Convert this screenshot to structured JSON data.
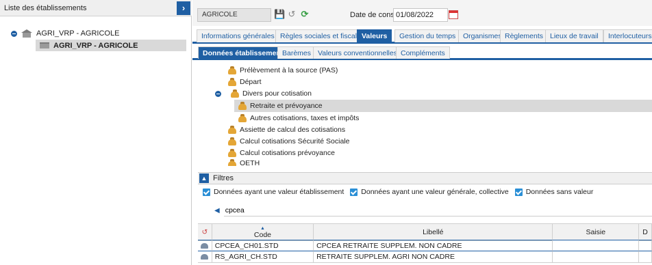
{
  "left_panel": {
    "title": "Liste des établissements",
    "collapse_glyph": "›",
    "tree": {
      "root_label": "AGRI_VRP - AGRICOLE",
      "child_label": "AGRI_VRP - AGRICOLE"
    }
  },
  "toolbar": {
    "establishment_value": "AGRICOLE",
    "save_icon": "save-icon",
    "undo_icon": "undo-icon",
    "refresh_icon": "refresh-icon",
    "consult_label": "Date de consultation",
    "consult_date": "01/08/2022",
    "calendar_icon": "calendar-icon"
  },
  "main_tabs": [
    "Informations générales",
    "Règles sociales et fiscales",
    "Valeurs",
    "Gestion du temps",
    "Organismes",
    "Règlements",
    "Lieux de travail",
    "Interlocuteurs"
  ],
  "main_tab_active": "Valeurs",
  "sub_tabs": [
    "Données établissement",
    "Barèmes",
    "Valeurs conventionnelles",
    "Compléments"
  ],
  "sub_tab_active": "Données établissement",
  "items": [
    "Prélèvement à la source (PAS)",
    "Départ",
    "Divers pour cotisation",
    "Retraite et prévoyance",
    "Autres cotisations, taxes et impôts",
    "Assiette de calcul des cotisations",
    "Calcul cotisations Sécurité Sociale",
    "Calcul cotisations prévoyance",
    "OETH"
  ],
  "selected_item": "Retraite et prévoyance",
  "filters": {
    "title": "Filtres",
    "options": [
      "Données ayant une valeur établissement",
      "Données ayant une valeur générale, collective",
      "Données sans valeur"
    ],
    "all_checked": true,
    "search_value": "cpcea"
  },
  "table": {
    "headers": [
      "Code",
      "Libellé",
      "Saisie",
      "D"
    ],
    "rows": [
      {
        "code": "CPCEA_CH01.STD",
        "libelle": "CPCEA  RETRAITE SUPPLEM. NON CADRE",
        "saisie": ""
      },
      {
        "code": "RS_AGRI_CH.STD",
        "libelle": "RETRAITE SUPPLEM. AGRI NON CADRE",
        "saisie": ""
      }
    ]
  },
  "colors": {
    "accent": "#1f5fa3",
    "selection": "#d9d9d9",
    "checkbox": "#2a8fd6",
    "refresh": "#3aa047"
  }
}
